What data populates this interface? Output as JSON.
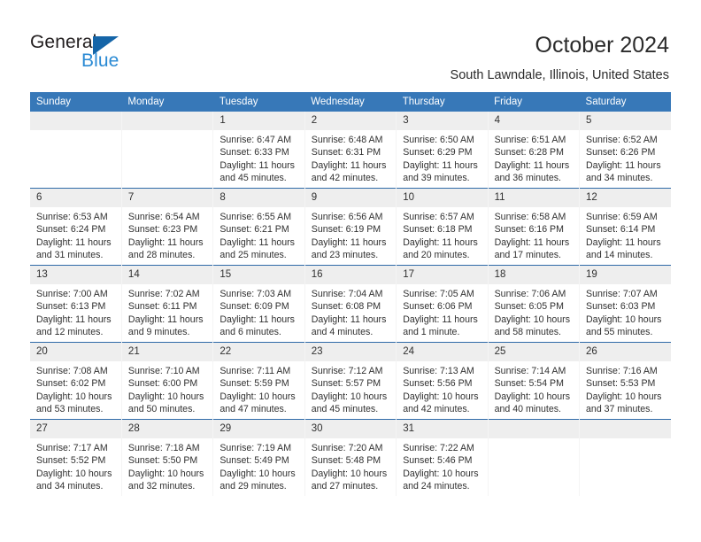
{
  "brand": {
    "name_part1": "General",
    "name_part2": "Blue",
    "accent_color": "#2a8ad4",
    "triangle_color": "#1565a8"
  },
  "header": {
    "title": "October 2024",
    "location": "South Lawndale, Illinois, United States"
  },
  "calendar": {
    "header_bg": "#3778b8",
    "daynum_bg": "#eeeeee",
    "week_rule_color": "#2f6aa8",
    "columns": [
      "Sunday",
      "Monday",
      "Tuesday",
      "Wednesday",
      "Thursday",
      "Friday",
      "Saturday"
    ],
    "weeks": [
      [
        {
          "day": "",
          "empty": true,
          "sunrise": "",
          "sunset": "",
          "daylight_1": "",
          "daylight_2": ""
        },
        {
          "day": "",
          "empty": true,
          "sunrise": "",
          "sunset": "",
          "daylight_1": "",
          "daylight_2": ""
        },
        {
          "day": "1",
          "sunrise": "Sunrise: 6:47 AM",
          "sunset": "Sunset: 6:33 PM",
          "daylight_1": "Daylight: 11 hours",
          "daylight_2": "and 45 minutes."
        },
        {
          "day": "2",
          "sunrise": "Sunrise: 6:48 AM",
          "sunset": "Sunset: 6:31 PM",
          "daylight_1": "Daylight: 11 hours",
          "daylight_2": "and 42 minutes."
        },
        {
          "day": "3",
          "sunrise": "Sunrise: 6:50 AM",
          "sunset": "Sunset: 6:29 PM",
          "daylight_1": "Daylight: 11 hours",
          "daylight_2": "and 39 minutes."
        },
        {
          "day": "4",
          "sunrise": "Sunrise: 6:51 AM",
          "sunset": "Sunset: 6:28 PM",
          "daylight_1": "Daylight: 11 hours",
          "daylight_2": "and 36 minutes."
        },
        {
          "day": "5",
          "sunrise": "Sunrise: 6:52 AM",
          "sunset": "Sunset: 6:26 PM",
          "daylight_1": "Daylight: 11 hours",
          "daylight_2": "and 34 minutes."
        }
      ],
      [
        {
          "day": "6",
          "sunrise": "Sunrise: 6:53 AM",
          "sunset": "Sunset: 6:24 PM",
          "daylight_1": "Daylight: 11 hours",
          "daylight_2": "and 31 minutes."
        },
        {
          "day": "7",
          "sunrise": "Sunrise: 6:54 AM",
          "sunset": "Sunset: 6:23 PM",
          "daylight_1": "Daylight: 11 hours",
          "daylight_2": "and 28 minutes."
        },
        {
          "day": "8",
          "sunrise": "Sunrise: 6:55 AM",
          "sunset": "Sunset: 6:21 PM",
          "daylight_1": "Daylight: 11 hours",
          "daylight_2": "and 25 minutes."
        },
        {
          "day": "9",
          "sunrise": "Sunrise: 6:56 AM",
          "sunset": "Sunset: 6:19 PM",
          "daylight_1": "Daylight: 11 hours",
          "daylight_2": "and 23 minutes."
        },
        {
          "day": "10",
          "sunrise": "Sunrise: 6:57 AM",
          "sunset": "Sunset: 6:18 PM",
          "daylight_1": "Daylight: 11 hours",
          "daylight_2": "and 20 minutes."
        },
        {
          "day": "11",
          "sunrise": "Sunrise: 6:58 AM",
          "sunset": "Sunset: 6:16 PM",
          "daylight_1": "Daylight: 11 hours",
          "daylight_2": "and 17 minutes."
        },
        {
          "day": "12",
          "sunrise": "Sunrise: 6:59 AM",
          "sunset": "Sunset: 6:14 PM",
          "daylight_1": "Daylight: 11 hours",
          "daylight_2": "and 14 minutes."
        }
      ],
      [
        {
          "day": "13",
          "sunrise": "Sunrise: 7:00 AM",
          "sunset": "Sunset: 6:13 PM",
          "daylight_1": "Daylight: 11 hours",
          "daylight_2": "and 12 minutes."
        },
        {
          "day": "14",
          "sunrise": "Sunrise: 7:02 AM",
          "sunset": "Sunset: 6:11 PM",
          "daylight_1": "Daylight: 11 hours",
          "daylight_2": "and 9 minutes."
        },
        {
          "day": "15",
          "sunrise": "Sunrise: 7:03 AM",
          "sunset": "Sunset: 6:09 PM",
          "daylight_1": "Daylight: 11 hours",
          "daylight_2": "and 6 minutes."
        },
        {
          "day": "16",
          "sunrise": "Sunrise: 7:04 AM",
          "sunset": "Sunset: 6:08 PM",
          "daylight_1": "Daylight: 11 hours",
          "daylight_2": "and 4 minutes."
        },
        {
          "day": "17",
          "sunrise": "Sunrise: 7:05 AM",
          "sunset": "Sunset: 6:06 PM",
          "daylight_1": "Daylight: 11 hours",
          "daylight_2": "and 1 minute."
        },
        {
          "day": "18",
          "sunrise": "Sunrise: 7:06 AM",
          "sunset": "Sunset: 6:05 PM",
          "daylight_1": "Daylight: 10 hours",
          "daylight_2": "and 58 minutes."
        },
        {
          "day": "19",
          "sunrise": "Sunrise: 7:07 AM",
          "sunset": "Sunset: 6:03 PM",
          "daylight_1": "Daylight: 10 hours",
          "daylight_2": "and 55 minutes."
        }
      ],
      [
        {
          "day": "20",
          "sunrise": "Sunrise: 7:08 AM",
          "sunset": "Sunset: 6:02 PM",
          "daylight_1": "Daylight: 10 hours",
          "daylight_2": "and 53 minutes."
        },
        {
          "day": "21",
          "sunrise": "Sunrise: 7:10 AM",
          "sunset": "Sunset: 6:00 PM",
          "daylight_1": "Daylight: 10 hours",
          "daylight_2": "and 50 minutes."
        },
        {
          "day": "22",
          "sunrise": "Sunrise: 7:11 AM",
          "sunset": "Sunset: 5:59 PM",
          "daylight_1": "Daylight: 10 hours",
          "daylight_2": "and 47 minutes."
        },
        {
          "day": "23",
          "sunrise": "Sunrise: 7:12 AM",
          "sunset": "Sunset: 5:57 PM",
          "daylight_1": "Daylight: 10 hours",
          "daylight_2": "and 45 minutes."
        },
        {
          "day": "24",
          "sunrise": "Sunrise: 7:13 AM",
          "sunset": "Sunset: 5:56 PM",
          "daylight_1": "Daylight: 10 hours",
          "daylight_2": "and 42 minutes."
        },
        {
          "day": "25",
          "sunrise": "Sunrise: 7:14 AM",
          "sunset": "Sunset: 5:54 PM",
          "daylight_1": "Daylight: 10 hours",
          "daylight_2": "and 40 minutes."
        },
        {
          "day": "26",
          "sunrise": "Sunrise: 7:16 AM",
          "sunset": "Sunset: 5:53 PM",
          "daylight_1": "Daylight: 10 hours",
          "daylight_2": "and 37 minutes."
        }
      ],
      [
        {
          "day": "27",
          "sunrise": "Sunrise: 7:17 AM",
          "sunset": "Sunset: 5:52 PM",
          "daylight_1": "Daylight: 10 hours",
          "daylight_2": "and 34 minutes."
        },
        {
          "day": "28",
          "sunrise": "Sunrise: 7:18 AM",
          "sunset": "Sunset: 5:50 PM",
          "daylight_1": "Daylight: 10 hours",
          "daylight_2": "and 32 minutes."
        },
        {
          "day": "29",
          "sunrise": "Sunrise: 7:19 AM",
          "sunset": "Sunset: 5:49 PM",
          "daylight_1": "Daylight: 10 hours",
          "daylight_2": "and 29 minutes."
        },
        {
          "day": "30",
          "sunrise": "Sunrise: 7:20 AM",
          "sunset": "Sunset: 5:48 PM",
          "daylight_1": "Daylight: 10 hours",
          "daylight_2": "and 27 minutes."
        },
        {
          "day": "31",
          "sunrise": "Sunrise: 7:22 AM",
          "sunset": "Sunset: 5:46 PM",
          "daylight_1": "Daylight: 10 hours",
          "daylight_2": "and 24 minutes."
        },
        {
          "day": "",
          "empty": true,
          "sunrise": "",
          "sunset": "",
          "daylight_1": "",
          "daylight_2": ""
        },
        {
          "day": "",
          "empty": true,
          "sunrise": "",
          "sunset": "",
          "daylight_1": "",
          "daylight_2": ""
        }
      ]
    ]
  }
}
